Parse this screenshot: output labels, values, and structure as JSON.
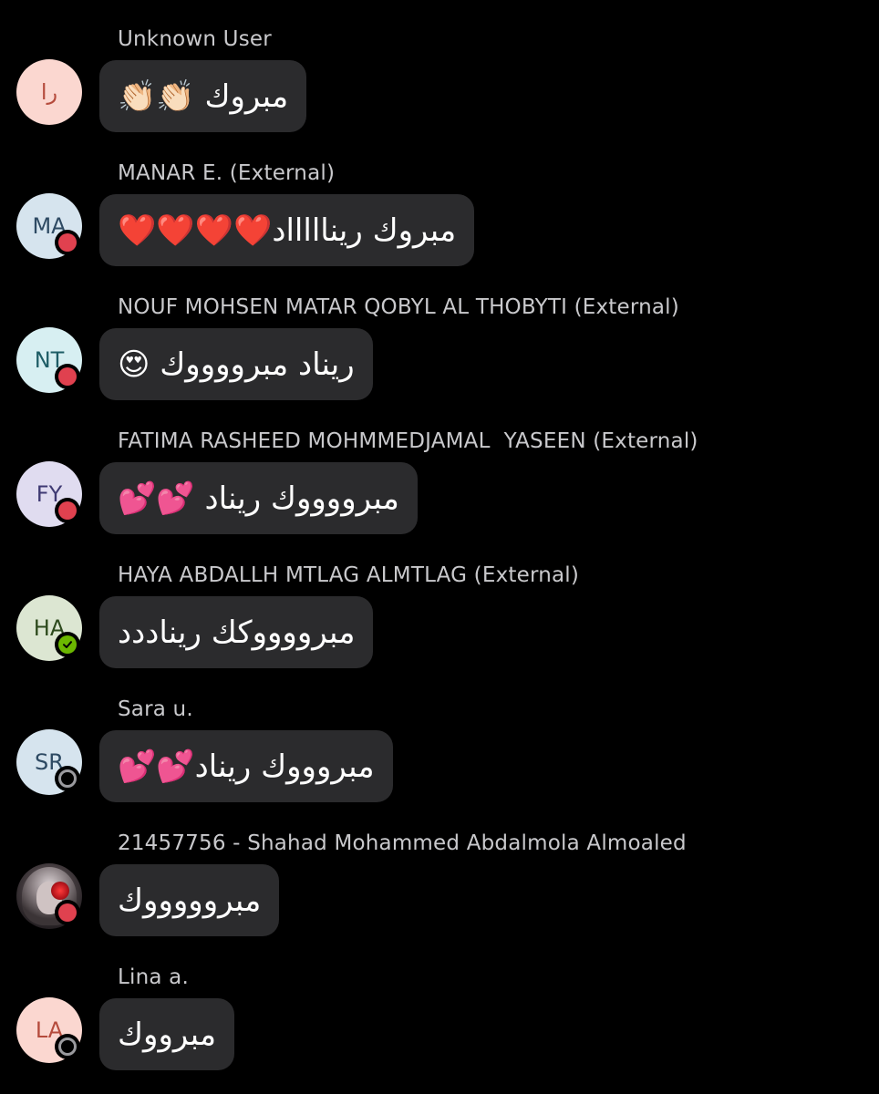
{
  "messages": [
    {
      "sender": "Unknown User",
      "initials": "را",
      "avatar_bg": "#fbd7d0",
      "avatar_fg": "#b54b3c",
      "status": "none",
      "text": "مبروك 👏🏻👏🏻"
    },
    {
      "sender": "MANAR E. (External)",
      "initials": "MA",
      "avatar_bg": "#d6e4ee",
      "avatar_fg": "#2e4a63",
      "status": "busy",
      "text": "مبروك ريناااااد❤️❤️❤️❤️"
    },
    {
      "sender": "NOUF MOHSEN MATAR QOBYL AL THOBYTI (External)",
      "initials": "NT",
      "avatar_bg": "#d7eff2",
      "avatar_fg": "#1e5d66",
      "status": "busy",
      "text": "ريناد مبرووووك 😍"
    },
    {
      "sender": "FATIMA RASHEED MOHMMEDJAMAL  YASEEN (External)",
      "initials": "FY",
      "avatar_bg": "#e0dcf0",
      "avatar_fg": "#3f3a73",
      "status": "busy",
      "text": "مبرووووك ريناد 💕💕"
    },
    {
      "sender": "HAYA ABDALLH MTLAG ALMTLAG (External)",
      "initials": "HA",
      "avatar_bg": "#dce6d2",
      "avatar_fg": "#2d4a1d",
      "status": "available",
      "text": "مبرووووكك ريناددد"
    },
    {
      "sender": "Sara u.",
      "initials": "SR",
      "avatar_bg": "#d6e4ee",
      "avatar_fg": "#2e4a63",
      "status": "offline",
      "text": "مبروووك ريناد💕💕"
    },
    {
      "sender": "21457756 - Shahad Mohammed Abdalmola Almoaled",
      "initials": "",
      "avatar_bg": "#2a2427",
      "avatar_fg": "#ffffff",
      "status": "busy",
      "photo": true,
      "text": "مبروووووك"
    },
    {
      "sender": "Lina a.",
      "initials": "LA",
      "avatar_bg": "#fbd7d0",
      "avatar_fg": "#b54b3c",
      "status": "offline",
      "text": "مبرووك"
    }
  ]
}
